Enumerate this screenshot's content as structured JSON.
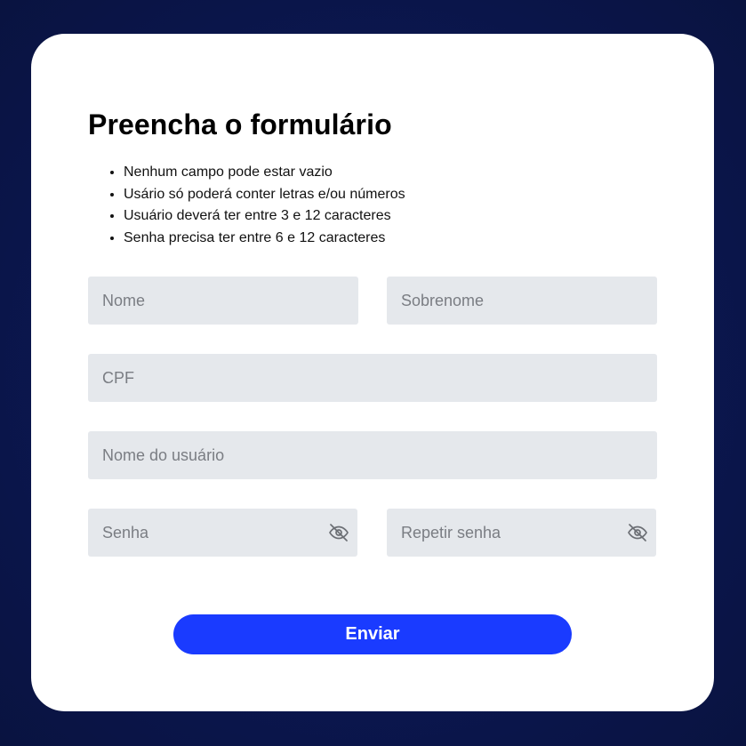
{
  "form": {
    "title": "Preencha o formulário",
    "rules": [
      "Nenhum campo pode estar vazio",
      "Usário só poderá conter letras e/ou números",
      "Usuário deverá ter entre 3 e 12 caracteres",
      "Senha precisa ter entre 6 e 12 caracteres"
    ],
    "fields": {
      "first_name": {
        "placeholder": "Nome",
        "value": ""
      },
      "last_name": {
        "placeholder": "Sobrenome",
        "value": ""
      },
      "cpf": {
        "placeholder": "CPF",
        "value": ""
      },
      "username": {
        "placeholder": "Nome do usuário",
        "value": ""
      },
      "password": {
        "placeholder": "Senha",
        "value": "",
        "icon": "eye-off-icon"
      },
      "password_confirm": {
        "placeholder": "Repetir senha",
        "value": "",
        "icon": "eye-off-icon"
      }
    },
    "submit_label": "Enviar"
  },
  "colors": {
    "background": "#0b164e",
    "card": "#ffffff",
    "field": "#e5e8ec",
    "button": "#1a3bff",
    "placeholder": "#7a7d83"
  }
}
